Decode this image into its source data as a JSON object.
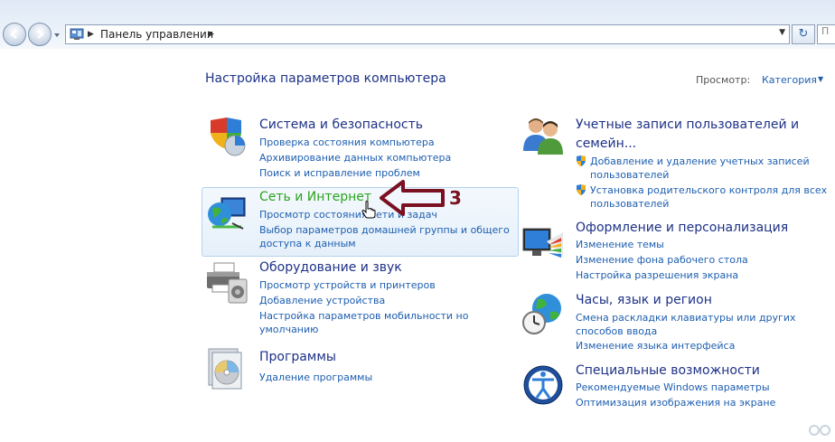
{
  "address_bar": {
    "breadcrumb": "Панель управления",
    "search_placeholder": "П"
  },
  "header": {
    "title": "Настройка параметров компьютера",
    "view_label": "Просмотр:",
    "view_value": "Категория"
  },
  "categories": [
    {
      "title": "Система и безопасность",
      "icon": "shield-chart-icon",
      "links": [
        "Проверка состояния компьютера",
        "Архивирование данных компьютера",
        "Поиск и исправление проблем"
      ]
    },
    {
      "title": "Сеть и Интернет",
      "icon": "globe-network-icon",
      "links": [
        "Просмотр состояния сети и задач",
        "Выбор параметров домашней группы и общего",
        "доступа к данным"
      ]
    },
    {
      "title": "Оборудование и звук",
      "icon": "printer-speaker-icon",
      "links": [
        "Просмотр устройств и принтеров",
        "Добавление устройства",
        "Настройка параметров мобильности но",
        "умолчанию"
      ]
    },
    {
      "title": "Программы",
      "icon": "programs-disc-icon",
      "links": [
        "Удаление программы"
      ]
    },
    {
      "title_lines": [
        "Учетные записи пользователей и",
        "семейн..."
      ],
      "icon": "users-icon",
      "links": [
        "Добавление и удаление учетных записей",
        "пользователей",
        "Установка родительского контроля для всех",
        "пользователей"
      ]
    },
    {
      "title": "Оформление и персонализация",
      "icon": "monitor-palette-icon",
      "links": [
        "Изменение темы",
        "Изменение фона рабочего стола",
        "Настройка разрешения экрана"
      ]
    },
    {
      "title": "Часы, язык и регион",
      "icon": "globe-clock-icon",
      "links": [
        "Смена раскладки клавиатуры или других",
        "способов ввода",
        "Изменение языка интерфейса"
      ]
    },
    {
      "title": "Специальные возможности",
      "icon": "accessibility-icon",
      "links": [
        "Рекомендуемые Windows параметры",
        "Оптимизация изображения на экране"
      ]
    }
  ],
  "annotation": {
    "number": "3",
    "color": "#7a1020"
  },
  "colors": {
    "heading": "#1e3287",
    "link": "#1e5fb0",
    "hover_title": "#2aa41e"
  }
}
